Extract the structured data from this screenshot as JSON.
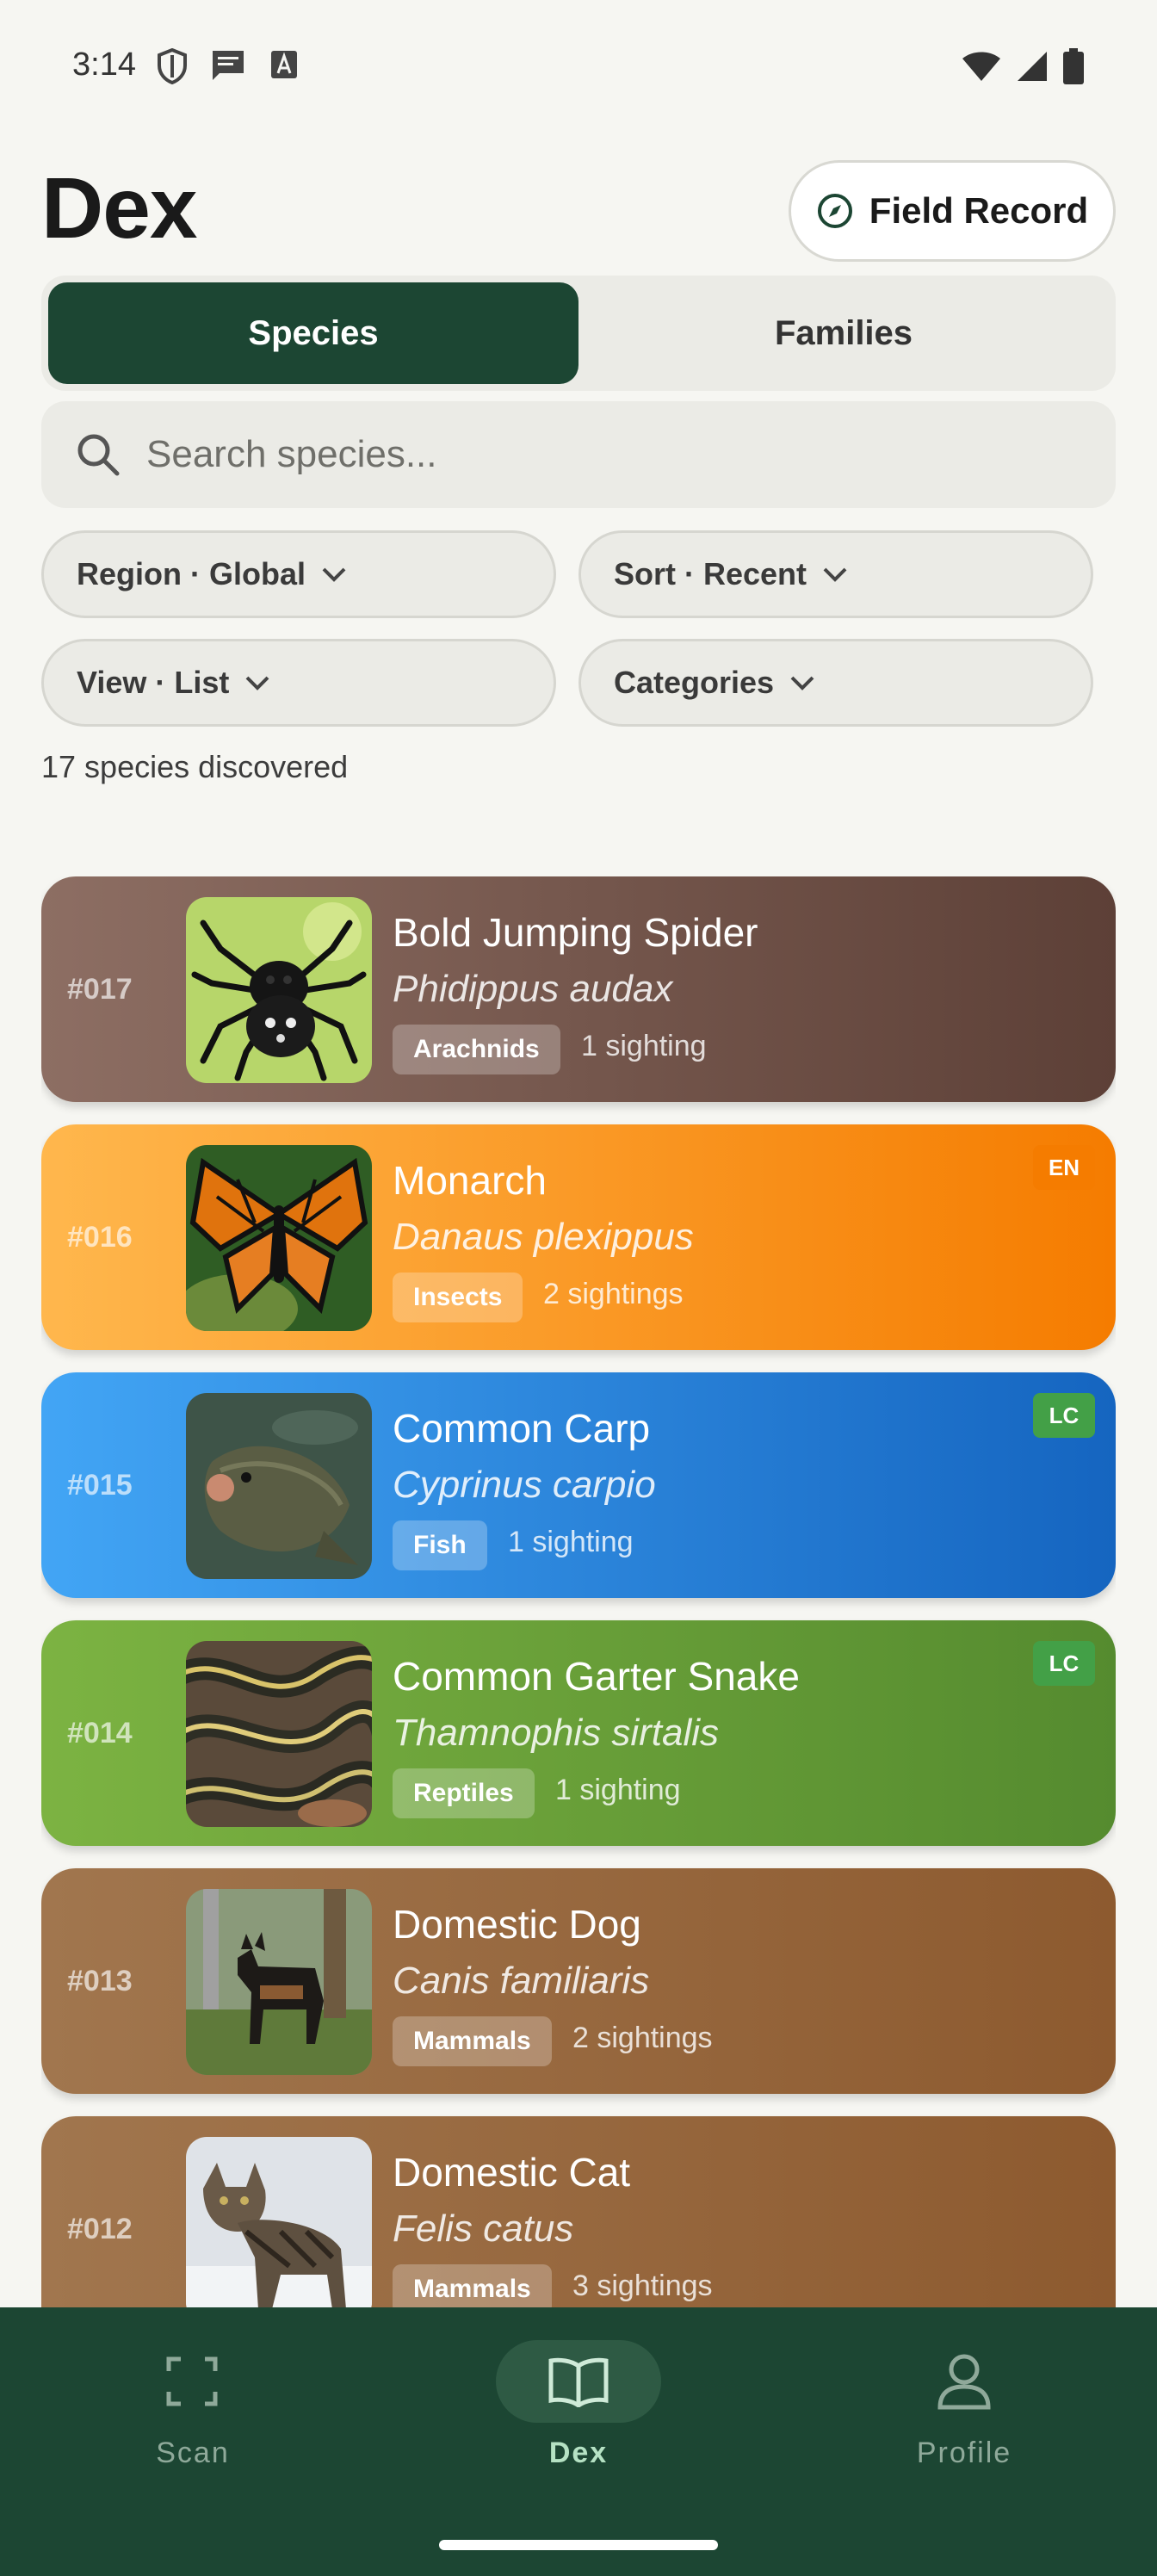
{
  "status_bar": {
    "time": "3:14",
    "icons": [
      "shield-icon",
      "message-icon",
      "font-icon",
      "wifi-icon",
      "signal-icon",
      "battery-icon"
    ]
  },
  "header": {
    "title": "Dex",
    "field_record_label": "Field Record",
    "field_record_icon": "compass-icon"
  },
  "tabs": [
    {
      "label": "Species",
      "active": true
    },
    {
      "label": "Families",
      "active": false
    }
  ],
  "search": {
    "placeholder": "Search species..."
  },
  "filters": {
    "region": "Region · Global",
    "sort": "Sort · Recent",
    "view": "View · List",
    "categories": "Categories"
  },
  "count_text": "17 species discovered",
  "species": [
    {
      "number": "#017",
      "name": "Bold Jumping Spider",
      "scientific": "Phidippus audax",
      "category": "Arachnids",
      "sightings": "1 sighting",
      "status": "",
      "colors": [
        "#8d6e63",
        "#5d4037"
      ]
    },
    {
      "number": "#016",
      "name": "Monarch",
      "scientific": "Danaus plexippus",
      "category": "Insects",
      "sightings": "2 sightings",
      "status": "EN",
      "status_color": "#f57c00",
      "colors": [
        "#ffb74d",
        "#f57c00"
      ]
    },
    {
      "number": "#015",
      "name": "Common Carp",
      "scientific": "Cyprinus carpio",
      "category": "Fish",
      "sightings": "1 sighting",
      "status": "LC",
      "status_color": "#43a047",
      "colors": [
        "#42a5f5",
        "#1565c0"
      ]
    },
    {
      "number": "#014",
      "name": "Common Garter Snake",
      "scientific": "Thamnophis sirtalis",
      "category": "Reptiles",
      "sightings": "1 sighting",
      "status": "LC",
      "status_color": "#43a047",
      "colors": [
        "#7cb342",
        "#558b2f"
      ]
    },
    {
      "number": "#013",
      "name": "Domestic Dog",
      "scientific": "Canis familiaris",
      "category": "Mammals",
      "sightings": "2 sightings",
      "status": "",
      "colors": [
        "#a1764e",
        "#8d5a2f"
      ]
    },
    {
      "number": "#012",
      "name": "Domestic Cat",
      "scientific": "Felis catus",
      "category": "Mammals",
      "sightings": "3 sightings",
      "status": "",
      "colors": [
        "#a1764e",
        "#8d5a2f"
      ]
    }
  ],
  "bottom_nav": [
    {
      "label": "Scan",
      "icon": "scan-icon",
      "active": false
    },
    {
      "label": "Dex",
      "icon": "book-icon",
      "active": true
    },
    {
      "label": "Profile",
      "icon": "person-icon",
      "active": false
    }
  ]
}
